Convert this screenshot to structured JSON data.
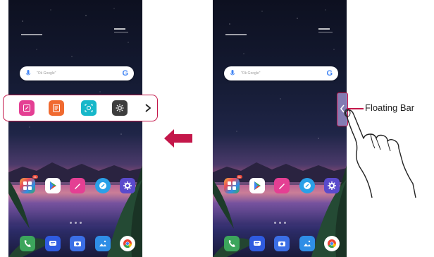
{
  "callout": {
    "label": "Floating Bar"
  },
  "screens": {
    "left": {
      "search_placeholder": "\"Ok Google\"",
      "folder_badge": "31"
    },
    "right": {
      "search_placeholder": "\"Ok Google\"",
      "folder_badge": "31"
    }
  },
  "floating_bar_items": [
    {
      "icon": "pen-icon",
      "color": "#e43f93"
    },
    {
      "icon": "list-icon",
      "color": "#f06a30"
    },
    {
      "icon": "capture-icon",
      "color": "#17b7c9"
    },
    {
      "icon": "settings-icon",
      "color": "#3d3d3d"
    }
  ],
  "colors": {
    "accent": "#c4174a",
    "phone": "#3ca55c",
    "messages": "#2f5be0",
    "camera": "#3b6fe6",
    "gallery": "#2f8ee6",
    "playstore": "#ffffff",
    "drawing": "#e43f93",
    "compass": "#2aa0e8",
    "settings": "#5a4acc"
  }
}
